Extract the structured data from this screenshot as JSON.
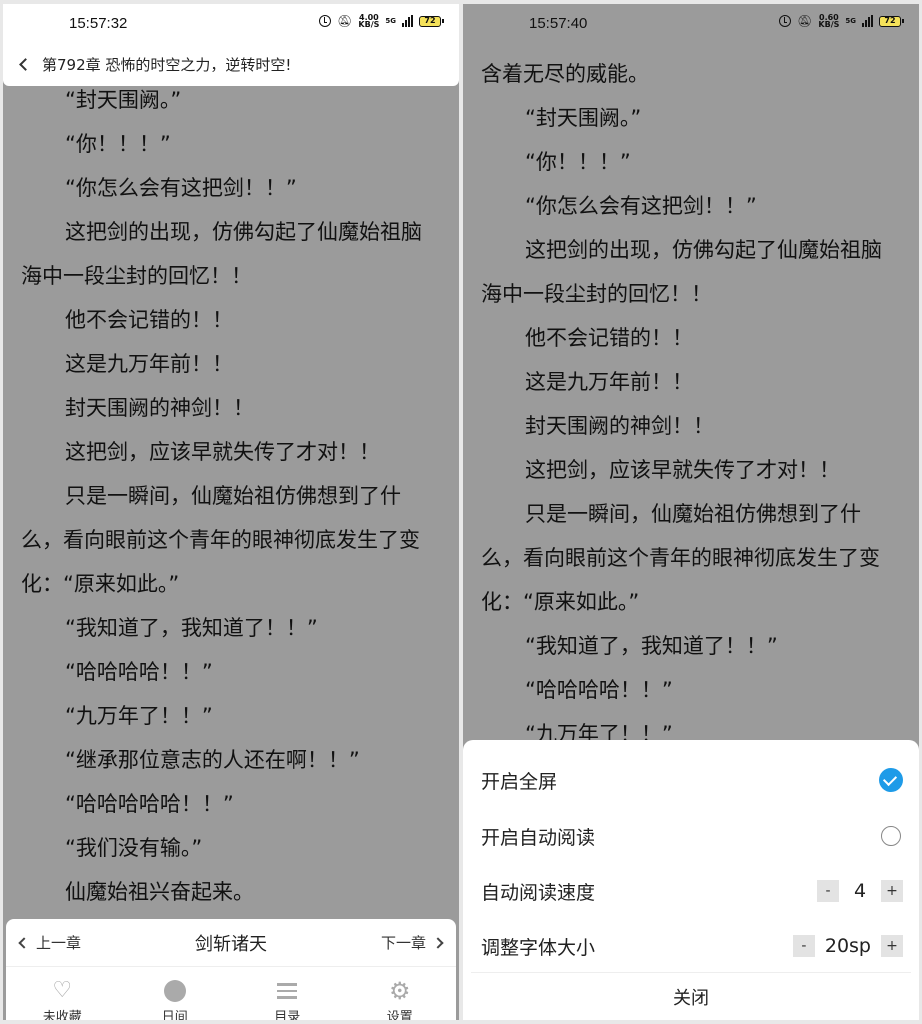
{
  "left": {
    "status": {
      "time": "15:57:32",
      "speed_value": "4.00",
      "speed_unit": "KB/S",
      "network": "5G",
      "battery": "72"
    },
    "chapter_title": "第792章 恐怖的时空之力，逆转时空!",
    "lines": [
      "“封天围阙。”",
      "“你！！！”",
      "“你怎么会有这把剑！！”",
      "这把剑的出现，仿佛勾起了仙魔始祖脑",
      "海中一段尘封的回忆！！",
      "他不会记错的！！",
      "这是九万年前！！",
      "封天围阙的神剑！！",
      "这把剑，应该早就失传了才对！！",
      "只是一瞬间，仙魔始祖仿佛想到了什",
      "么，看向眼前这个青年的眼神彻底发生了变",
      "化：“原来如此。”",
      "“我知道了，我知道了！！”",
      "“哈哈哈哈！！”",
      "“九万年了！！”",
      "“继承那位意志的人还在啊！！”",
      "“哈哈哈哈哈！！”",
      "“我们没有输。”",
      "仙魔始祖兴奋起来。"
    ],
    "nav": {
      "prev": "上一章",
      "book_title": "剑斩诸天",
      "next": "下一章"
    },
    "tabs": [
      {
        "label": "未收藏",
        "icon": "heart-icon"
      },
      {
        "label": "日间",
        "icon": "day-mode-icon"
      },
      {
        "label": "目录",
        "icon": "list-icon"
      },
      {
        "label": "设置",
        "icon": "gear-icon"
      }
    ]
  },
  "right": {
    "status": {
      "time": "15:57:40",
      "speed_value": "0.60",
      "speed_unit": "KB/S",
      "network": "5G",
      "battery": "72"
    },
    "lines": [
      "含着无尽的威能。",
      "“封天围阙。”",
      "“你！！！”",
      "“你怎么会有这把剑！！”",
      "这把剑的出现，仿佛勾起了仙魔始祖脑",
      "海中一段尘封的回忆！！",
      "他不会记错的！！",
      "这是九万年前！！",
      "封天围阙的神剑！！",
      "这把剑，应该早就失传了才对！！",
      "只是一瞬间，仙魔始祖仿佛想到了什",
      "么，看向眼前这个青年的眼神彻底发生了变",
      "化：“原来如此。”",
      "“我知道了，我知道了！！”",
      "“哈哈哈哈！！”",
      "“九万年了！！”"
    ],
    "settings": {
      "fullscreen_label": "开启全屏",
      "fullscreen_on": true,
      "autoread_label": "开启自动阅读",
      "autoread_on": false,
      "speed_label": "自动阅读速度",
      "speed_value": "4",
      "fontsize_label": "调整字体大小",
      "fontsize_value": "20sp",
      "minus": "-",
      "plus": "+",
      "close_label": "关闭"
    }
  }
}
